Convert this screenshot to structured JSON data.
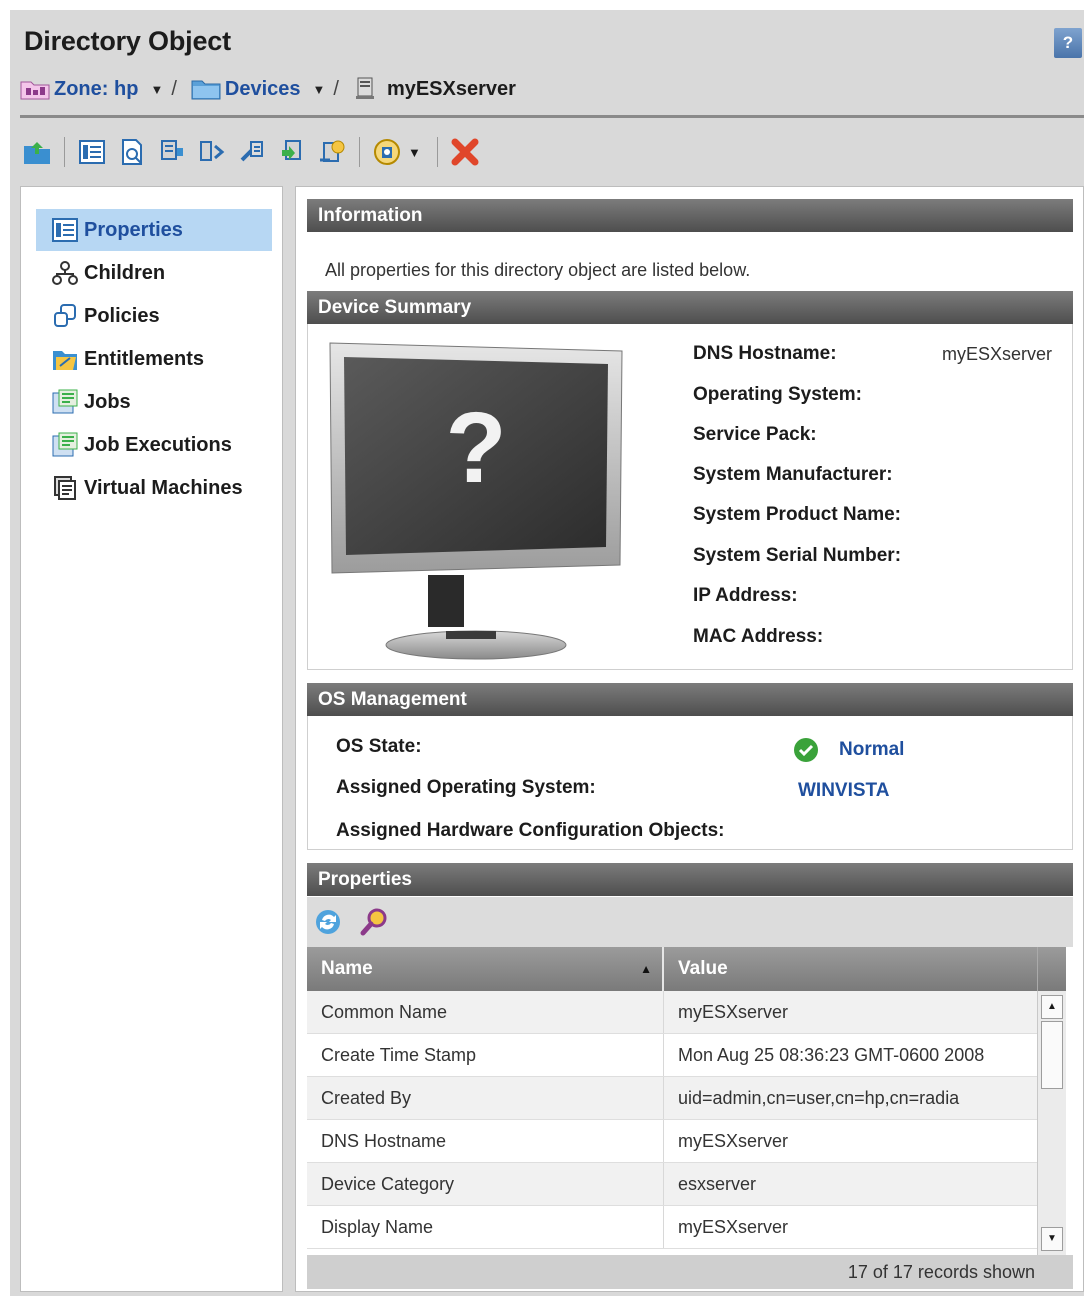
{
  "page": {
    "title": "Directory Object",
    "help_label": "?"
  },
  "breadcrumb": {
    "zone": "Zone: hp",
    "devices": "Devices",
    "current": "myESXserver",
    "separator": "/"
  },
  "toolbar": {
    "icons": [
      "upload-icon",
      "properties-view-icon",
      "preview-icon",
      "device-icon",
      "compare-icon",
      "link-icon",
      "deploy-icon",
      "policy-icon",
      "settings-icon",
      "delete-icon"
    ]
  },
  "nav": {
    "items": [
      {
        "label": "Properties",
        "icon": "properties-icon",
        "active": true
      },
      {
        "label": "Children",
        "icon": "children-icon"
      },
      {
        "label": "Policies",
        "icon": "policies-icon"
      },
      {
        "label": "Entitlements",
        "icon": "entitlements-icon"
      },
      {
        "label": "Jobs",
        "icon": "jobs-icon"
      },
      {
        "label": "Job Executions",
        "icon": "job-executions-icon"
      },
      {
        "label": "Virtual Machines",
        "icon": "virtual-machines-icon"
      }
    ]
  },
  "information": {
    "header": "Information",
    "text": "All properties for this directory object are listed below."
  },
  "device_summary": {
    "header": "Device Summary",
    "image_glyph": "?",
    "fields": [
      {
        "label": "DNS Hostname:",
        "value": "myESXserver"
      },
      {
        "label": "Operating System:",
        "value": ""
      },
      {
        "label": "Service Pack:",
        "value": ""
      },
      {
        "label": "System Manufacturer:",
        "value": ""
      },
      {
        "label": "System Product Name:",
        "value": ""
      },
      {
        "label": "System Serial Number:",
        "value": ""
      },
      {
        "label": "IP Address:",
        "value": ""
      },
      {
        "label": "MAC Address:",
        "value": ""
      }
    ]
  },
  "os_management": {
    "header": "OS Management",
    "os_state_label": "OS State:",
    "os_state_value": "Normal",
    "assigned_os_label": "Assigned Operating System:",
    "assigned_os_value": "WINVISTA",
    "hw_config_label": "Assigned Hardware Configuration Objects:"
  },
  "properties": {
    "header": "Properties",
    "columns": {
      "name": "Name",
      "value": "Value"
    },
    "rows": [
      {
        "name": "Common Name",
        "value": "myESXserver"
      },
      {
        "name": "Create Time Stamp",
        "value": "Mon Aug 25 08:36:23 GMT-0600 2008"
      },
      {
        "name": "Created By",
        "value": "uid=admin,cn=user,cn=hp,cn=radia"
      },
      {
        "name": "DNS Hostname",
        "value": "myESXserver"
      },
      {
        "name": "Device Category",
        "value": "esxserver"
      },
      {
        "name": "Display Name",
        "value": "myESXserver"
      }
    ],
    "records_shown": "17 of 17 records shown"
  },
  "colors": {
    "accent": "#1f4f9e",
    "nav_active": "#b7d7f3",
    "section_header": "#5a5a5a",
    "ok_green": "#3aa23a",
    "delete_red": "#e0462a"
  }
}
